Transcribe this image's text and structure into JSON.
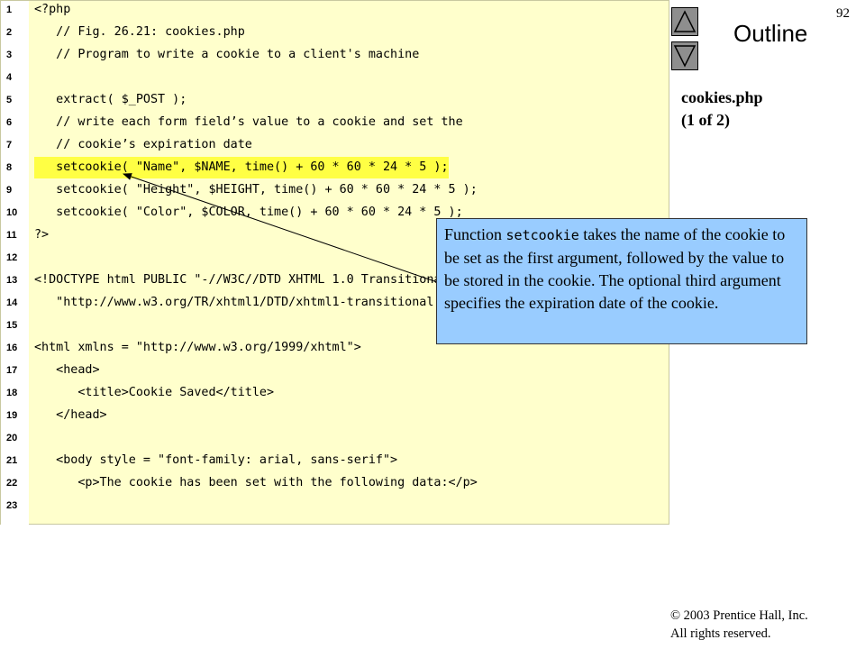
{
  "slide_number": "92",
  "outline_title": "Outline",
  "side_note": {
    "file": "cookies.php",
    "page": "(1 of 2)"
  },
  "nav": {
    "up_icon": "triangle-up-icon",
    "down_icon": "triangle-down-icon"
  },
  "code_lines": [
    {
      "n": "1",
      "text": "<?php"
    },
    {
      "n": "2",
      "text": "   // Fig. 26.21: cookies.php"
    },
    {
      "n": "3",
      "text": "   // Program to write a cookie to a client's machine"
    },
    {
      "n": "4",
      "text": ""
    },
    {
      "n": "5",
      "text": "   extract( $_POST );"
    },
    {
      "n": "6",
      "text": "   // write each form field’s value to a cookie and set the"
    },
    {
      "n": "7",
      "text": "   // cookie’s expiration date"
    },
    {
      "n": "8",
      "text": "   setcookie( \"Name\", $NAME, time() + 60 * 60 * 24 * 5 );"
    },
    {
      "n": "9",
      "text": "   setcookie( \"Height\", $HEIGHT, time() + 60 * 60 * 24 * 5 );"
    },
    {
      "n": "10",
      "text": "   setcookie( \"Color\", $COLOR, time() + 60 * 60 * 24 * 5 );"
    },
    {
      "n": "11",
      "text": "?>"
    },
    {
      "n": "12",
      "text": ""
    },
    {
      "n": "13",
      "text": "<!DOCTYPE html PUBLIC \"-//W3C//DTD XHTML 1.0 Transitional//EN\""
    },
    {
      "n": "14",
      "text": "   \"http://www.w3.org/TR/xhtml1/DTD/xhtml1-transitional.dtd\">"
    },
    {
      "n": "15",
      "text": ""
    },
    {
      "n": "16",
      "text": "<html xmlns = \"http://www.w3.org/1999/xhtml\">"
    },
    {
      "n": "17",
      "text": "   <head>"
    },
    {
      "n": "18",
      "text": "      <title>Cookie Saved</title>"
    },
    {
      "n": "19",
      "text": "   </head>"
    },
    {
      "n": "20",
      "text": ""
    },
    {
      "n": "21",
      "text": "   <body style = \"font-family: arial, sans-serif\">"
    },
    {
      "n": "22",
      "text": "      <p>The cookie has been set with the following data:</p>"
    },
    {
      "n": "23",
      "text": ""
    }
  ],
  "highlighted_line_index": 7,
  "callout": {
    "before": "Function ",
    "code": "setcookie",
    "after": " takes the name of the cookie to be set as the first argument, followed by the value to be stored in the cookie. The optional third argument specifies the expiration date of the cookie."
  },
  "copyright": {
    "line1": "© 2003 Prentice Hall, Inc.",
    "line2": "All rights reserved."
  },
  "colors": {
    "code_background": "#ffffcc",
    "callout_background": "#99ccff",
    "highlight": "#ffff44",
    "nav_button": "#8e8e8e"
  }
}
